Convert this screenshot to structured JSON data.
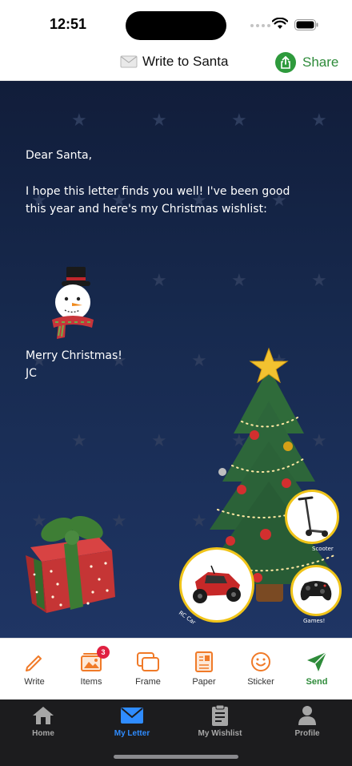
{
  "status_bar": {
    "time": "12:51"
  },
  "header": {
    "title": "Write to Santa",
    "share_label": "Share"
  },
  "letter": {
    "greeting": "Dear Santa,",
    "body": "I hope this letter finds you well! I've been good\nthis year and here's my Christmas wishlist:",
    "closing": "Merry Christmas!\nJC",
    "wishlist_items": [
      {
        "label": "Scooter"
      },
      {
        "label": "RC Car"
      },
      {
        "label": "Games!"
      }
    ]
  },
  "toolbar": {
    "items": [
      {
        "label": "Write",
        "icon": "pencil-icon"
      },
      {
        "label": "Items",
        "icon": "photos-icon",
        "badge": "3"
      },
      {
        "label": "Frame",
        "icon": "frame-icon"
      },
      {
        "label": "Paper",
        "icon": "paper-icon"
      },
      {
        "label": "Sticker",
        "icon": "smiley-icon"
      },
      {
        "label": "Send",
        "icon": "paper-plane-icon"
      }
    ]
  },
  "tabbar": {
    "items": [
      {
        "label": "Home",
        "icon": "house-icon"
      },
      {
        "label": "My Letter",
        "icon": "envelope-icon",
        "active": true
      },
      {
        "label": "My Wishlist",
        "icon": "clipboard-icon"
      },
      {
        "label": "Profile",
        "icon": "person-icon"
      }
    ]
  },
  "colors": {
    "accent_green": "#2e8b3a",
    "tab_active": "#2f8cff",
    "letter_bg": "#172a4f",
    "badge": "#e02040"
  }
}
